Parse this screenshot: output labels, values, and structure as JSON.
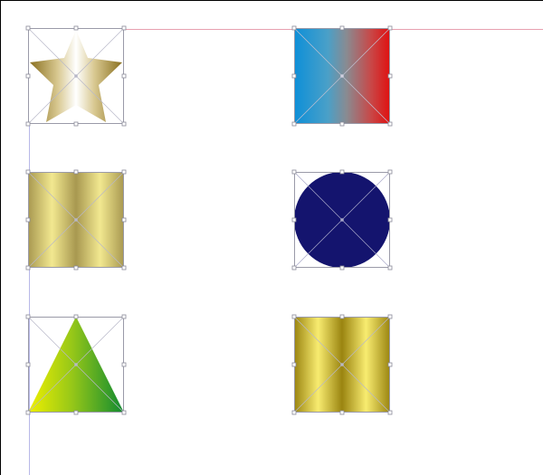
{
  "canvas": {
    "background": "#ffffff",
    "guide_color_horizontal": "#e8a0b0",
    "guide_color_vertical": "#b8b8e8",
    "selection_color": "#9a9aa8"
  },
  "objects": [
    {
      "name": "star",
      "shape": "star",
      "fill": "gradient-gold-silver"
    },
    {
      "name": "blue-red-square",
      "shape": "square",
      "fill": "gradient-blue-red"
    },
    {
      "name": "gold-columns-1",
      "shape": "columns",
      "fill": "gradient-gold"
    },
    {
      "name": "navy-circle",
      "shape": "circle",
      "fill": "#14146e"
    },
    {
      "name": "triangle",
      "shape": "triangle",
      "fill": "gradient-yellow-green"
    },
    {
      "name": "gold-columns-2",
      "shape": "columns",
      "fill": "gradient-gold-deep"
    }
  ]
}
